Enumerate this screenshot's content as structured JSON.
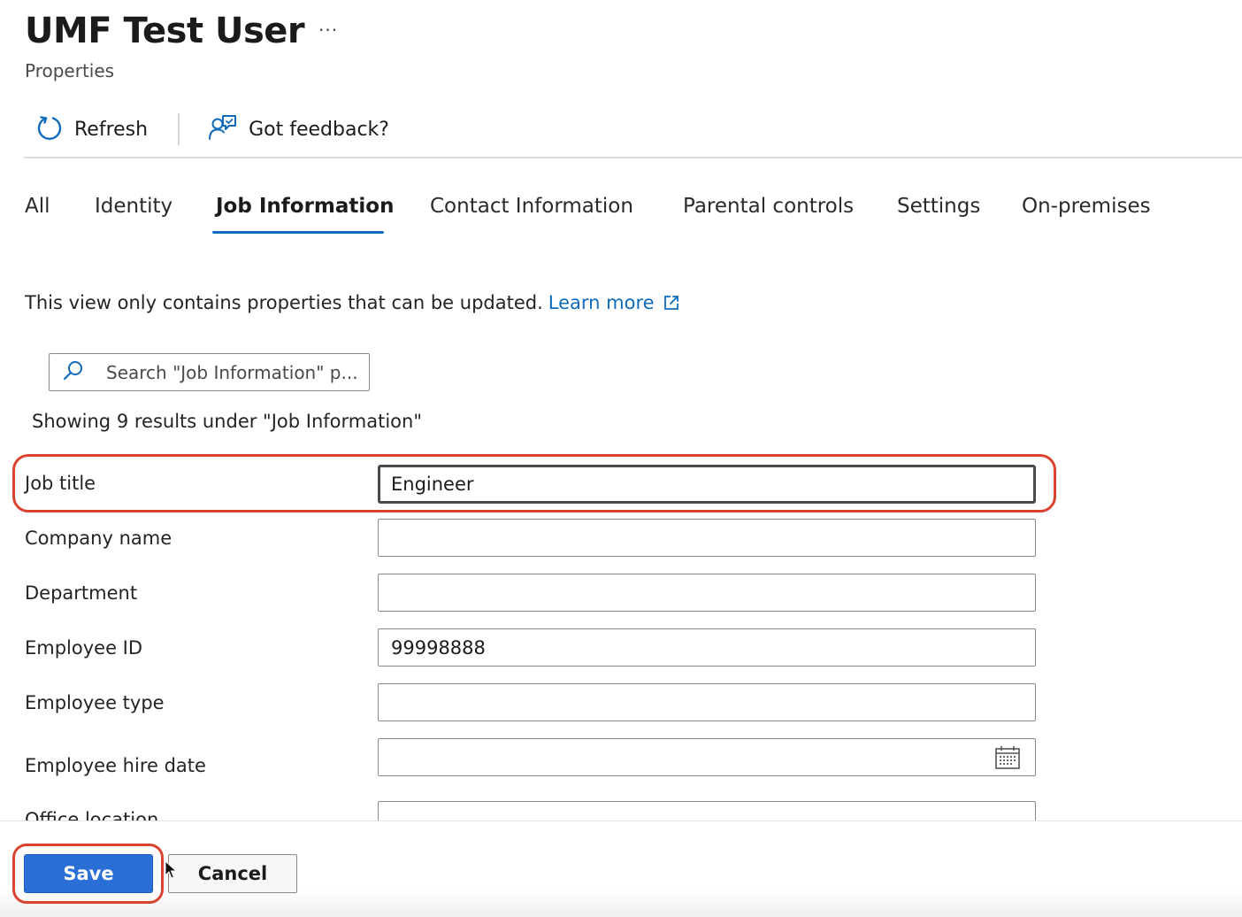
{
  "header": {
    "title": "UMF Test User",
    "more_label": "···",
    "subtitle": "Properties"
  },
  "toolbar": {
    "refresh_label": "Refresh",
    "feedback_label": "Got feedback?"
  },
  "tabs": [
    {
      "label": "All",
      "active": false
    },
    {
      "label": "Identity",
      "active": false
    },
    {
      "label": "Job Information",
      "active": true
    },
    {
      "label": "Contact Information",
      "active": false
    },
    {
      "label": "Parental controls",
      "active": false
    },
    {
      "label": "Settings",
      "active": false
    },
    {
      "label": "On-premises",
      "active": false
    }
  ],
  "notice": {
    "text": "This view only contains properties that can be updated.",
    "link_label": "Learn more"
  },
  "search": {
    "placeholder": "Search \"Job Information\" p..."
  },
  "results_text": "Showing 9 results under \"Job Information\"",
  "fields": {
    "job_title": {
      "label": "Job title",
      "value": "Engineer"
    },
    "company_name": {
      "label": "Company name",
      "value": ""
    },
    "department": {
      "label": "Department",
      "value": ""
    },
    "employee_id": {
      "label": "Employee ID",
      "value": "99998888"
    },
    "employee_type": {
      "label": "Employee type",
      "value": ""
    },
    "employee_hire_date": {
      "label": "Employee hire date",
      "value": ""
    },
    "office_location": {
      "label": "Office location",
      "value": ""
    }
  },
  "footer": {
    "save_label": "Save",
    "cancel_label": "Cancel"
  },
  "colors": {
    "accent": "#0f6cbd",
    "primary_button": "#2a6fd6",
    "highlight_annotation": "#d9432f"
  }
}
